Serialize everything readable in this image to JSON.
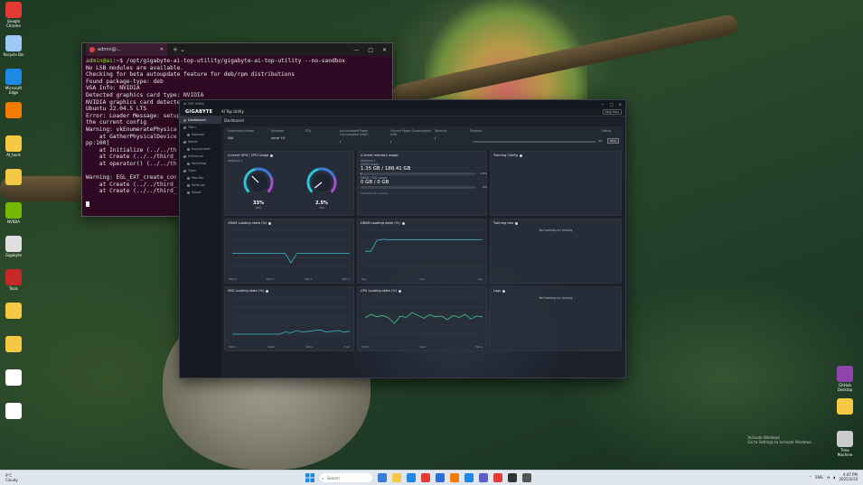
{
  "desktop": {
    "left_icons": [
      {
        "label": "Google Chrome",
        "icon": "chrome-icon",
        "color": "#e53935"
      },
      {
        "label": "Recycle Bin",
        "icon": "recycle-bin-icon",
        "color": "#9ec9f5"
      },
      {
        "label": "Microsoft Edge",
        "icon": "edge-icon",
        "color": "#1e88e5"
      },
      {
        "label": "",
        "icon": "app-icon",
        "color": "#f57c00"
      },
      {
        "label": "AI_tools",
        "icon": "folder-icon",
        "color": "#f6c945"
      },
      {
        "label": "",
        "icon": "folder-icon",
        "color": "#f6c945"
      },
      {
        "label": "NVIDIA",
        "icon": "nvidia-icon",
        "color": "#76b900"
      },
      {
        "label": "Gigabyte",
        "icon": "gauge-icon",
        "color": "#e0e0e0"
      },
      {
        "label": "Tools",
        "icon": "tools-icon",
        "color": "#c62828"
      },
      {
        "label": "",
        "icon": "folder-icon",
        "color": "#f6c945"
      },
      {
        "label": "",
        "icon": "folder-icon",
        "color": "#f6c945"
      },
      {
        "label": "",
        "icon": "document-icon",
        "color": "#ffffff"
      },
      {
        "label": "",
        "icon": "document-icon",
        "color": "#ffffff"
      }
    ],
    "right_icons": [
      {
        "label": "GitHub Desktop",
        "icon": "github-icon",
        "color": "#8e44ad"
      },
      {
        "label": "",
        "icon": "folder-icon",
        "color": "#f6c945"
      },
      {
        "label": "Time Machine",
        "icon": "clock-icon",
        "color": "#cccccc"
      }
    ],
    "watermark": [
      "Activate Windows",
      "Go to Settings to activate Windows."
    ]
  },
  "terminal": {
    "tab_title": "admin@...",
    "window_controls": [
      "—",
      "□",
      "✕"
    ],
    "prompt_user": "admin@ai",
    "command": ":~$ /opt/gigabyte-ai-top-utility/gigabyte-ai-top-utility --no-sandbox",
    "lines": [
      "No LSB modules are available.",
      "Checking for beta autoupdate feature for deb/rpm distributions",
      "Found package-type: deb",
      "VGA Info: NVIDIA",
      "Detected graphics card type: NVIDIA",
      "NVIDIA graphics card detected",
      "Ubuntu 22.04.5 LTS",
      "Error: Loader Message: setup",
      "the current config",
      "Warning: vkEnumeratePhysica",
      "    at GatherPhysicalDevice",
      "pp:100]",
      "    at Initialize (../../th",
      "    at Create (../../third_",
      "    at operator() (../../th",
      "",
      "Warning: EGL_EXT_create_con",
      "    at Create (../../third_",
      "    at Create (../../third_"
    ]
  },
  "app": {
    "window_title": "AI TOP Utility",
    "window_controls": [
      "—",
      "□",
      "✕"
    ],
    "brand": "GIGABYTE",
    "tab": "AI Top Utility",
    "header_button": "Stop Train",
    "nav": [
      {
        "label": "Dashboard",
        "active": true,
        "sub": false
      },
      {
        "label": "Train",
        "active": false,
        "sub": false
      },
      {
        "label": "Dataset",
        "active": false,
        "sub": true
      },
      {
        "label": "Model",
        "active": false,
        "sub": false
      },
      {
        "label": "Experiment",
        "active": false,
        "sub": true
      },
      {
        "label": "Inference",
        "active": false,
        "sub": false
      },
      {
        "label": "Workflow",
        "active": false,
        "sub": true
      },
      {
        "label": "Tools",
        "active": false,
        "sub": false
      },
      {
        "label": "Monitor",
        "active": false,
        "sub": true
      },
      {
        "label": "Settings",
        "active": false,
        "sub": true
      },
      {
        "label": "About",
        "active": false,
        "sub": true
      }
    ],
    "page_title": "Dashboard",
    "info": {
      "cols": [
        {
          "label": "Experiment Name",
          "value": "N/A"
        },
        {
          "label": "Estimate",
          "value": "none +0"
        },
        {
          "label": "ETA",
          "value": ""
        },
        {
          "label": "Accumulated Power Consumption (kWh)",
          "value": "/"
        },
        {
          "label": "Current Power Consumption (kW)",
          "value": "/"
        },
        {
          "label": "Tokens/s",
          "value": "/"
        },
        {
          "label": "Progress",
          "value": ""
        },
        {
          "label": "Status",
          "value": ""
        }
      ],
      "progress": 0,
      "progress_text": "0%",
      "stop_label": "Stop"
    },
    "panels": {
      "gpu_cpu": {
        "title": "Current GPU / CPU Usage",
        "subtitle": "Instance 1",
        "gauges": [
          {
            "value": 33,
            "text": "33%",
            "label": "GPU"
          },
          {
            "value": 2.5,
            "text": "2.5%",
            "label": "CPU"
          }
        ]
      },
      "memory": {
        "title": "Current memory usage",
        "subtitle": "Instance 1",
        "rows": [
          {
            "label": "DRAM usage",
            "value": "1.35 GB / 188.41 GB",
            "fraction": 0.01,
            "pct": "1.5%"
          },
          {
            "label": "VRAM / SSD usage",
            "value": "0 GB / 0 GB",
            "fraction": 0.0,
            "pct": "0%"
          }
        ],
        "footer": "Checkpoint: 0 in/out"
      },
      "training_config": {
        "title": "Training Config"
      },
      "training_loss": {
        "title": "Training loss",
        "empty": "No training is running"
      },
      "logs": {
        "title": "Logs",
        "empty": "No training is running"
      },
      "vram_chart": {
        "title": "VRAM Loading state (%)",
        "legend": [
          "GPU 0",
          "GPU 1",
          "GPU 2",
          "GPU 3"
        ]
      },
      "dram_chart": {
        "title": "DRAM Loading state (%)",
        "legend": [
          "Use",
          "Use",
          "Use"
        ]
      },
      "ssd_chart": {
        "title": "SSD Loading state (%)",
        "legend": [
          "SSD 0",
          "Read",
          "Write",
          "Free"
        ]
      },
      "cpu_chart": {
        "title": "CPU Loading state (%)",
        "legend": [
          "CPU 0",
          "Load",
          "Temp"
        ]
      }
    }
  },
  "chart_data": [
    {
      "type": "line",
      "title": "VRAM Loading state (%)",
      "x": [
        0,
        1,
        2,
        3,
        4,
        5,
        6,
        7,
        8,
        9,
        10,
        11,
        12,
        13,
        14,
        15,
        16,
        17,
        18,
        19,
        20
      ],
      "series": [
        {
          "name": "GPU 0",
          "values": [
            36,
            36,
            36,
            36,
            36,
            36,
            36,
            36,
            36,
            36,
            10,
            36,
            36,
            36,
            36,
            36,
            36,
            36,
            36,
            36,
            36
          ]
        }
      ],
      "ylim": [
        0,
        100
      ]
    },
    {
      "type": "line",
      "title": "DRAM Loading state (%)",
      "x": [
        0,
        1,
        2,
        3,
        4,
        5,
        6,
        7,
        8,
        9,
        10,
        11,
        12,
        13,
        14,
        15,
        16,
        17,
        18,
        19,
        20
      ],
      "series": [
        {
          "name": "Use",
          "values": [
            42,
            42,
            72,
            75,
            74,
            74,
            74,
            74,
            74,
            74,
            74,
            74,
            74,
            74,
            74,
            74,
            74,
            74,
            74,
            74,
            74
          ]
        }
      ],
      "ylim": [
        0,
        100
      ]
    },
    {
      "type": "line",
      "title": "SSD Loading state (%)",
      "x": [
        0,
        1,
        2,
        3,
        4,
        5,
        6,
        7,
        8,
        9,
        10,
        11,
        12,
        13,
        14,
        15,
        16,
        17,
        18,
        19,
        20
      ],
      "series": [
        {
          "name": "SSD 0",
          "values": [
            0,
            0,
            0,
            0,
            0,
            0,
            0,
            0,
            0,
            6,
            4,
            10,
            6,
            8,
            10,
            12,
            6,
            8,
            10,
            6,
            8
          ]
        }
      ],
      "ylim": [
        0,
        100
      ]
    },
    {
      "type": "line",
      "title": "CPU Loading state (%)",
      "x": [
        0,
        1,
        2,
        3,
        4,
        5,
        6,
        7,
        8,
        9,
        10,
        11,
        12,
        13,
        14,
        15,
        16,
        17,
        18,
        19,
        20
      ],
      "series": [
        {
          "name": "CPU 0",
          "values": [
            45,
            55,
            48,
            52,
            45,
            30,
            50,
            46,
            60,
            52,
            44,
            54,
            48,
            50,
            40,
            52,
            46,
            55,
            42,
            50,
            48
          ]
        }
      ],
      "ylim": [
        0,
        100
      ]
    }
  ],
  "taskbar": {
    "weather": [
      "9°C",
      "Cloudy"
    ],
    "search_placeholder": "Search",
    "apps": [
      {
        "icon": "widgets-icon",
        "color": "#3a7bd5"
      },
      {
        "icon": "file-explorer-icon",
        "color": "#f6c945"
      },
      {
        "icon": "edge-icon",
        "color": "#1e88e5"
      },
      {
        "icon": "chrome-icon",
        "color": "#e53935"
      },
      {
        "icon": "store-icon",
        "color": "#2a6fd6"
      },
      {
        "icon": "app-icon",
        "color": "#f57c00"
      },
      {
        "icon": "vscode-icon",
        "color": "#1e88e5"
      },
      {
        "icon": "teams-icon",
        "color": "#5b5fc7"
      },
      {
        "icon": "chrome-icon",
        "color": "#e53935"
      },
      {
        "icon": "terminal-icon",
        "color": "#333333"
      },
      {
        "icon": "app-icon",
        "color": "#555555"
      }
    ],
    "tray": {
      "lang": "ENG",
      "time": "4:47 PM",
      "date": "2025/3/10"
    }
  }
}
